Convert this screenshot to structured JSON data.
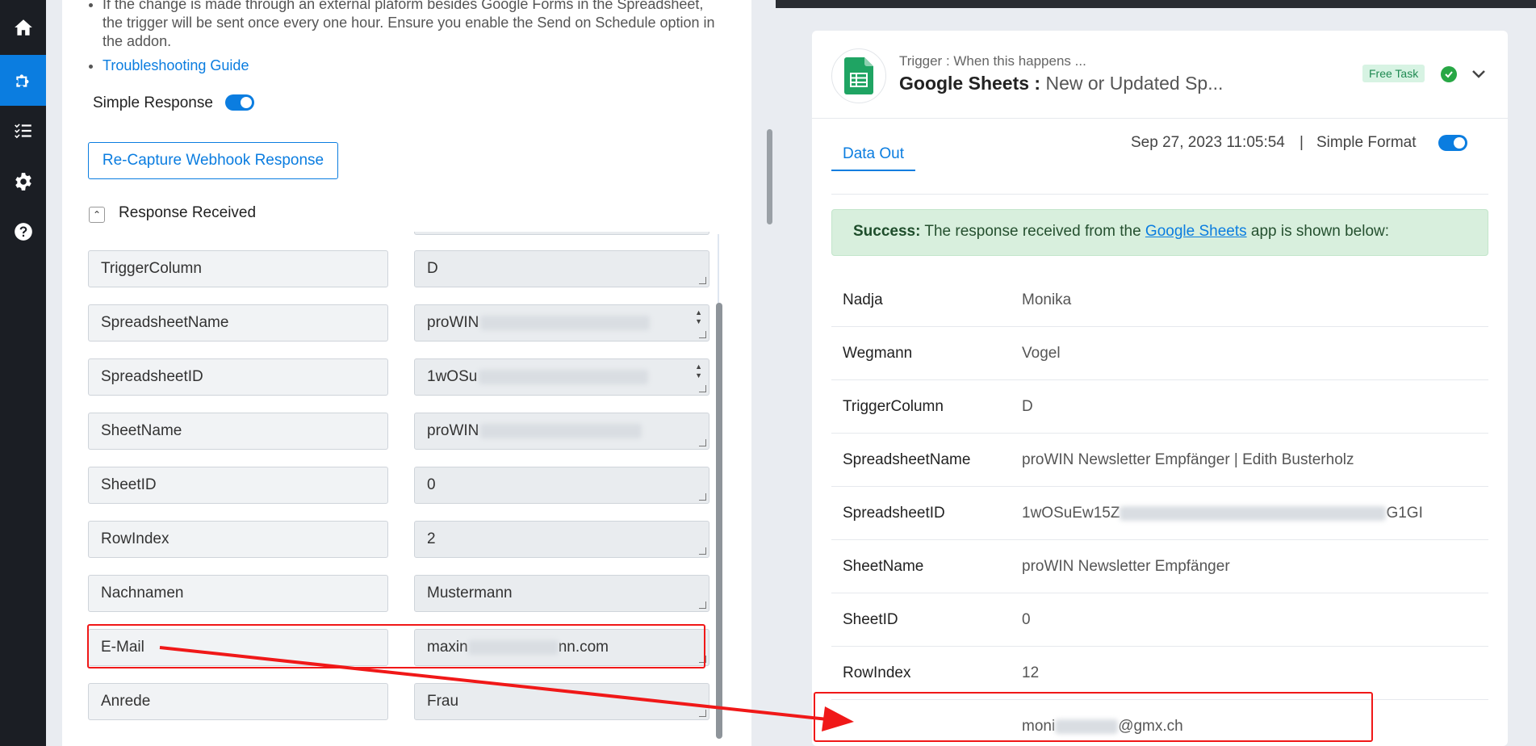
{
  "left_panel": {
    "bullet_text": "If the change is made through an external plaform besides Google Forms in the Spreadsheet, the trigger will be sent once every one hour. Ensure you enable the Send on Schedule option in the addon.",
    "troubleshooting_link": "Troubleshooting Guide",
    "simple_response_label": "Simple Response",
    "simple_response_on": true,
    "recapture_button": "Re-Capture Webhook Response",
    "response_received_label": "Response Received",
    "fields": [
      {
        "key": "TriggerColumn",
        "value": "D"
      },
      {
        "key": "SpreadsheetName",
        "value": "proWIN",
        "redacted": true
      },
      {
        "key": "SpreadsheetID",
        "value": "1wOSu",
        "redacted": true
      },
      {
        "key": "SheetName",
        "value": "proWIN",
        "redacted": true
      },
      {
        "key": "SheetID",
        "value": "0"
      },
      {
        "key": "RowIndex",
        "value": "2"
      },
      {
        "key": "Nachnamen",
        "value": "Mustermann"
      },
      {
        "key": "E-Mail",
        "value_prefix": "maxin",
        "value_suffix": "nn.com",
        "redacted": true
      },
      {
        "key": "Anrede",
        "value": "Frau"
      }
    ]
  },
  "card": {
    "trigger_label": "Trigger : When this happens ...",
    "app_name": "Google Sheets :",
    "event_name": "New or Updated Sp...",
    "free_task_badge": "Free Task",
    "tab_data_out": "Data Out",
    "timestamp": "Sep 27, 2023 11:05:54",
    "separator": "|",
    "simple_format_label": "Simple Format",
    "success_bold": "Success:",
    "success_text_1": " The response received from the ",
    "success_link": "Google Sheets",
    "success_text_2": " app is shown below:",
    "rows": [
      {
        "key": "Nadja",
        "value": "Monika"
      },
      {
        "key": "Wegmann",
        "value": "Vogel"
      },
      {
        "key": "TriggerColumn",
        "value": "D"
      },
      {
        "key": "SpreadsheetName",
        "value": "proWIN Newsletter Empfänger | Edith Busterholz"
      },
      {
        "key": "SpreadsheetID",
        "value_prefix": "1wOSuEw15Z",
        "value_suffix": "G1GI"
      },
      {
        "key": "SheetName",
        "value": "proWIN Newsletter Empfänger"
      },
      {
        "key": "SheetID",
        "value": "0"
      },
      {
        "key": "RowIndex",
        "value": "12"
      },
      {
        "key": "",
        "value_prefix": "moni",
        "value_suffix": "@gmx.ch"
      }
    ]
  },
  "colors": {
    "accent": "#0b7de0",
    "nav_bg": "#1b1e24",
    "annotation_red": "#f01818",
    "success_bg": "#d8efdd"
  }
}
